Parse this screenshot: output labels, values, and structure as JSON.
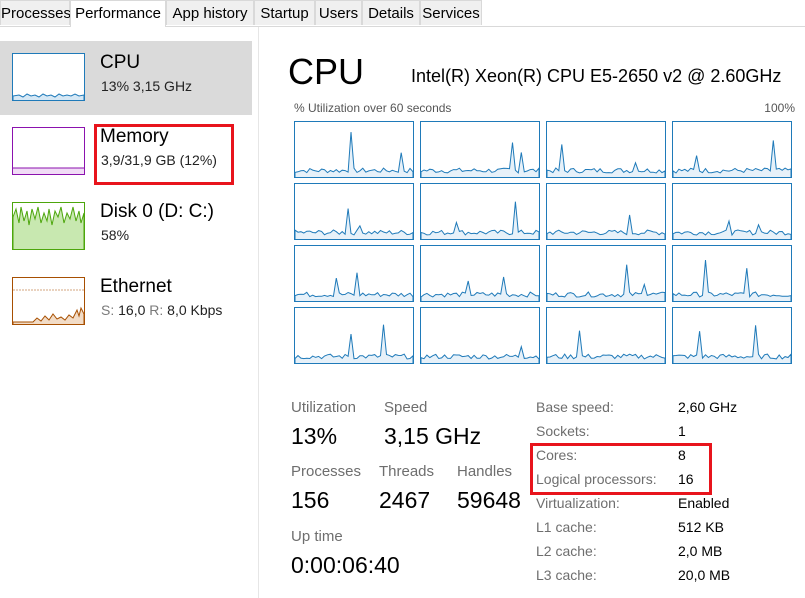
{
  "tabs": [
    "Processes",
    "Performance",
    "App history",
    "Startup",
    "Users",
    "Details",
    "Services"
  ],
  "sidebar": {
    "items": [
      {
        "title": "CPU",
        "subtitle": "13% 3,15 GHz",
        "color": "#1f7ab9"
      },
      {
        "title": "Memory",
        "subtitle": "3,9/31,9 GB (12%)",
        "color": "#8b12ae"
      },
      {
        "title": "Disk 0 (D: C:)",
        "subtitle": "58%",
        "color": "#4da60c"
      },
      {
        "title": "Ethernet",
        "subtitle_s_label": "S:",
        "subtitle_s_value": "16,0",
        "subtitle_r_label": "R:",
        "subtitle_r_value": "8,0 Kbps",
        "color": "#a74f01"
      }
    ]
  },
  "main": {
    "title": "CPU",
    "model": "Intel(R) Xeon(R) CPU E5-2650 v2 @ 2.60GHz",
    "util_label": "% Utilization over 60 seconds",
    "util_max": "100%",
    "stats": {
      "utilization": {
        "label": "Utilization",
        "value": "13%"
      },
      "speed": {
        "label": "Speed",
        "value": "3,15 GHz"
      },
      "processes": {
        "label": "Processes",
        "value": "156"
      },
      "threads": {
        "label": "Threads",
        "value": "2467"
      },
      "handles": {
        "label": "Handles",
        "value": "59648"
      },
      "uptime": {
        "label": "Up time",
        "value": "0:00:06:40"
      }
    },
    "details": [
      {
        "label": "Base speed:",
        "value": "2,60 GHz"
      },
      {
        "label": "Sockets:",
        "value": "1"
      },
      {
        "label": "Cores:",
        "value": "8"
      },
      {
        "label": "Logical processors:",
        "value": "16"
      },
      {
        "label": "Virtualization:",
        "value": "Enabled"
      },
      {
        "label": "L1 cache:",
        "value": "512 KB"
      },
      {
        "label": "L2 cache:",
        "value": "2,0 MB"
      },
      {
        "label": "L3 cache:",
        "value": "20,0 MB"
      }
    ]
  },
  "colors": {
    "cpu": "#1f7ab9",
    "highlight": "#e8141c",
    "selected_bg": "#dadada"
  }
}
